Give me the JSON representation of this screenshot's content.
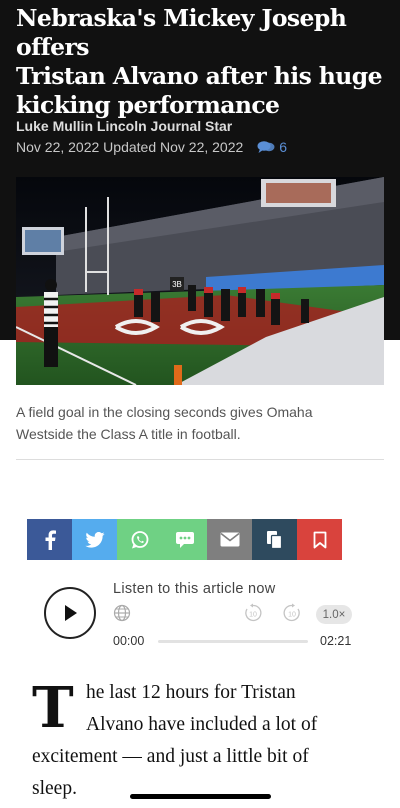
{
  "article": {
    "headline_line1": "Nebraska's Mickey Joseph offers",
    "headline_line2": "Tristan Alvano after his huge",
    "headline_line3": "kicking performance",
    "byline": "Luke Mullin Lincoln Journal Star",
    "dates": "Nov 22, 2022 Updated Nov 22, 2022",
    "comment_count": "6",
    "photo_scoreboard_text": "3B",
    "caption_line1": "A field goal in the closing seconds gives Omaha",
    "caption_line2": "Westside the Class A title in football.",
    "body_dropcap": "T",
    "body_line1": "he last 12 hours for Tristan",
    "body_line2": "Alvano have included a lot of",
    "body_line3": "excitement — and just a little bit of",
    "body_line4": "sleep."
  },
  "share_bar": {
    "buttons": [
      {
        "name": "facebook",
        "icon": "facebook-icon",
        "color": "#3b5998"
      },
      {
        "name": "twitter",
        "icon": "twitter-icon",
        "color": "#55acee"
      },
      {
        "name": "whatsapp",
        "icon": "whatsapp-icon",
        "color": "#6fd184"
      },
      {
        "name": "sms",
        "icon": "sms-icon",
        "color": "#6fd184"
      },
      {
        "name": "email",
        "icon": "email-icon",
        "color": "#7f7f7f"
      },
      {
        "name": "copy",
        "icon": "copy-icon",
        "color": "#2e4a5e"
      },
      {
        "name": "bookmark",
        "icon": "bookmark-icon",
        "color": "#d9433d"
      }
    ]
  },
  "audio": {
    "label": "Listen to this article now",
    "speed": "1.0×",
    "skip_back": "10",
    "skip_forward": "10",
    "current_time": "00:00",
    "duration": "02:21",
    "progress": 0
  },
  "colors": {
    "hero_bg": "#111111",
    "comment_accent": "#5b8fd6",
    "field_green": "#2f6b2a",
    "end_zone_red": "#b01a1f"
  }
}
